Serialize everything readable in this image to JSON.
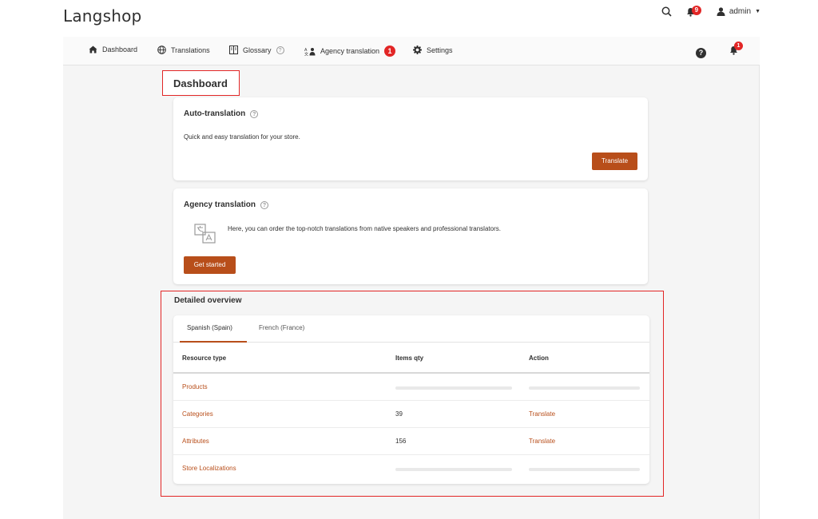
{
  "header": {
    "brand": "Langshop",
    "notifications_count": "9",
    "user": "admin"
  },
  "nav": {
    "items": [
      {
        "label": "Dashboard",
        "icon": "home-icon"
      },
      {
        "label": "Translations",
        "icon": "globe-icon"
      },
      {
        "label": "Glossary",
        "icon": "book-icon"
      },
      {
        "label": "Agency translation",
        "icon": "language-icon",
        "badge": "1"
      },
      {
        "label": "Settings",
        "icon": "gear-icon"
      }
    ],
    "help_label": "?",
    "bell_badge": "1"
  },
  "page": {
    "title": "Dashboard"
  },
  "auto_translation": {
    "title": "Auto-translation",
    "text": "Quick and easy translation for your store.",
    "button": "Translate"
  },
  "agency_translation": {
    "title": "Agency translation",
    "text": "Here, you can order the top-notch translations from native speakers and professional translators.",
    "button": "Get started"
  },
  "overview": {
    "title": "Detailed overview",
    "tabs": [
      "Spanish (Spain)",
      "French (France)"
    ],
    "columns": [
      "Resource type",
      "Items qty",
      "Action"
    ],
    "rows": [
      {
        "resource": "Products",
        "qty": "",
        "action": ""
      },
      {
        "resource": "Categories",
        "qty": "39",
        "action": "Translate"
      },
      {
        "resource": "Attributes",
        "qty": "156",
        "action": "Translate"
      },
      {
        "resource": "Store Localizations",
        "qty": "",
        "action": ""
      }
    ]
  },
  "colors": {
    "accent": "#b84e1a",
    "badge": "#e22626",
    "highlight_border": "#e22626"
  }
}
